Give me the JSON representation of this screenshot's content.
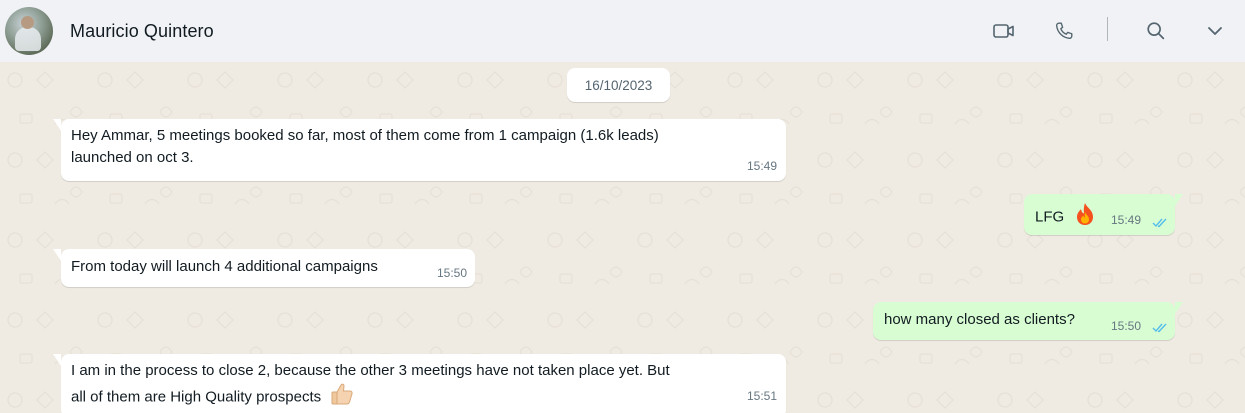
{
  "contact": {
    "name": "Mauricio Quintero",
    "avatar_icon": "contact-photo"
  },
  "header_actions": [
    {
      "name": "video-call",
      "icon": "video-camera-icon"
    },
    {
      "name": "voice-call",
      "icon": "phone-icon"
    },
    {
      "name": "search",
      "icon": "search-icon"
    },
    {
      "name": "menu",
      "icon": "chevron-down-icon"
    }
  ],
  "chat": {
    "date": "16/10/2023",
    "messages": [
      {
        "direction": "in",
        "line1": "Hey Ammar, 5 meetings booked so far, most of them come from 1 campaign (1.6k leads)",
        "line2": "launched on oct 3.",
        "time": "15:49"
      },
      {
        "direction": "out",
        "text": "LFG",
        "emoji": "fire-emoji",
        "time": "15:49",
        "status": "read"
      },
      {
        "direction": "in",
        "text": "From today will launch 4 additional campaigns",
        "time": "15:50"
      },
      {
        "direction": "out",
        "text": "how many closed as clients?",
        "time": "15:50",
        "status": "read"
      },
      {
        "direction": "in",
        "line1": "I am in the process to close 2, because the other 3 meetings have not taken place yet. But",
        "line2": "all of them are High Quality prospects",
        "emoji": "thumbs-up-emoji",
        "time": "15:51"
      }
    ]
  },
  "colors": {
    "header_bg": "#f0f2f5",
    "chat_bg": "#efeae2",
    "incoming_bubble": "#ffffff",
    "outgoing_bubble": "#d9fdd3",
    "read_ticks": "#53bdeb"
  }
}
